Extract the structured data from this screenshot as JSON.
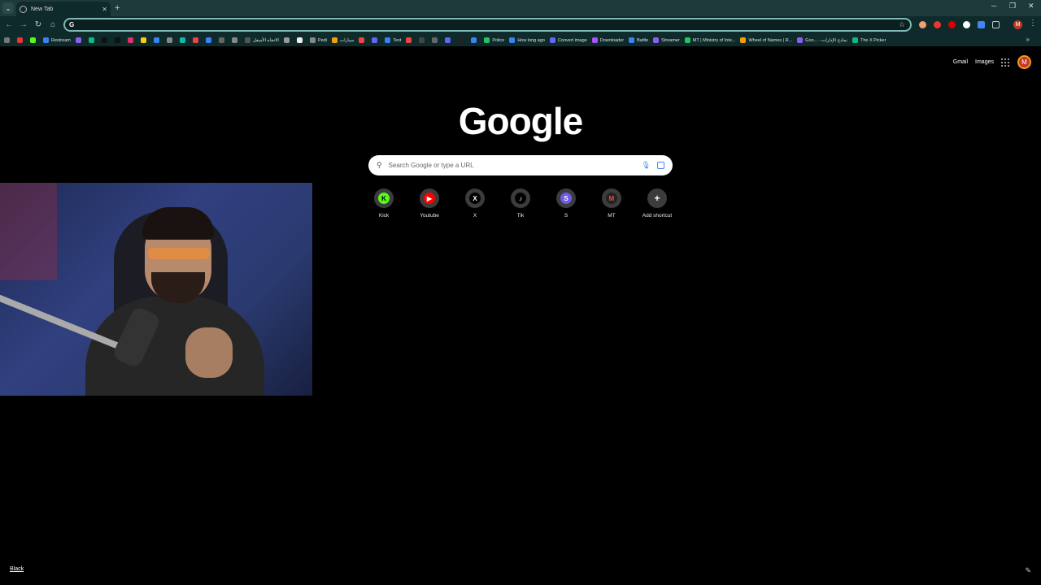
{
  "tab": {
    "title": "New Tab",
    "close": "✕"
  },
  "window": {
    "minimize": "─",
    "restore": "❐",
    "close": "✕"
  },
  "omnibox": {
    "value": ""
  },
  "bookmarks": [
    {
      "label": "",
      "color": "#e33"
    },
    {
      "label": "",
      "color": "#53fc18"
    },
    {
      "label": "Restream",
      "color": "#3b82f6"
    },
    {
      "label": "",
      "color": "#8b5cf6"
    },
    {
      "label": "",
      "color": "#10b981"
    },
    {
      "label": "",
      "color": "#111"
    },
    {
      "label": "",
      "color": "#111"
    },
    {
      "label": "",
      "color": "#e1306c"
    },
    {
      "label": "",
      "color": "#facc15"
    },
    {
      "label": "",
      "color": "#3b82f6"
    },
    {
      "label": "",
      "color": "#888"
    },
    {
      "label": "",
      "color": "#14b8a6"
    },
    {
      "label": "",
      "color": "#ef4444"
    },
    {
      "label": "",
      "color": "#3b82f6"
    },
    {
      "label": "",
      "color": "#666"
    },
    {
      "label": "",
      "color": "#888"
    },
    {
      "label": "الاتجاه الأسفل",
      "color": "#555"
    },
    {
      "label": "",
      "color": "#999"
    },
    {
      "label": "",
      "color": "#eee"
    },
    {
      "label": "Pedi",
      "color": "#888"
    },
    {
      "label": "سيارات",
      "color": "#f59e0b"
    },
    {
      "label": "",
      "color": "#ef4444"
    },
    {
      "label": "",
      "color": "#6366f1"
    },
    {
      "label": "Text",
      "color": "#3b82f6"
    },
    {
      "label": "",
      "color": "#ef4444"
    },
    {
      "label": "",
      "color": "#444"
    },
    {
      "label": "",
      "color": "#666"
    },
    {
      "label": "",
      "color": "#6366f1"
    },
    {
      "label": "",
      "color": "#222"
    },
    {
      "label": "",
      "color": "#3b82f6"
    },
    {
      "label": "Police",
      "color": "#22c55e"
    },
    {
      "label": "How long ago",
      "color": "#3b82f6"
    },
    {
      "label": "Convert image",
      "color": "#6366f1"
    },
    {
      "label": "Downloader",
      "color": "#a855f7"
    },
    {
      "label": "Battle",
      "color": "#3b82f6"
    },
    {
      "label": "Streamer",
      "color": "#8b5cf6"
    },
    {
      "label": "MT | Ministry of Inte...",
      "color": "#22c55e"
    },
    {
      "label": "Wheel of Names | R...",
      "color": "#f59e0b"
    },
    {
      "label": "Goo... - نماذج الإدارات",
      "color": "#8b5cf6"
    },
    {
      "label": "The X Picker",
      "color": "#10b981"
    }
  ],
  "bookmarks_more": "»",
  "header": {
    "gmail": "Gmail",
    "images": "Images",
    "avatar_letter": "M"
  },
  "logo": "Google",
  "search": {
    "placeholder": "Search Google or type a URL"
  },
  "shortcuts": [
    {
      "label": "Kick",
      "glyph": "K",
      "color": "#53fc18",
      "text_color": "#000"
    },
    {
      "label": "Youtube",
      "glyph": "▶",
      "color": "#ff0000",
      "text_color": "#fff"
    },
    {
      "label": "X",
      "glyph": "X",
      "color": "#000",
      "text_color": "#fff"
    },
    {
      "label": "Tik",
      "glyph": "♪",
      "color": "#000",
      "text_color": "#fff"
    },
    {
      "label": "S",
      "glyph": "S",
      "color": "#6c5ce7",
      "text_color": "#fff"
    },
    {
      "label": "MT",
      "glyph": "M",
      "color": "#222",
      "text_color": "#e74c3c"
    },
    {
      "label": "Add shortcut",
      "glyph": "+",
      "color": "transparent",
      "text_color": "#fff"
    }
  ],
  "footer": {
    "link": "Black",
    "edit": "✎"
  }
}
